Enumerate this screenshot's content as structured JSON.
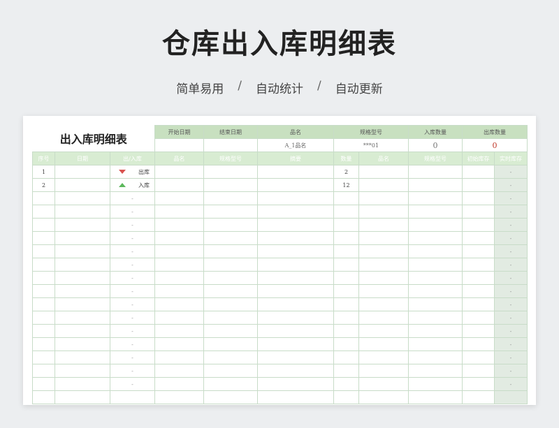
{
  "hero": {
    "title": "仓库出入库明细表",
    "tagline": [
      "简单易用",
      "自动统计",
      "自动更新"
    ],
    "separator": "/"
  },
  "sheet": {
    "title": "出入库明细表",
    "summary_headers": [
      "开始日期",
      "结束日期",
      "品名",
      "规格型号",
      "入库数量",
      "出库数量"
    ],
    "summary_values": {
      "start_date": "",
      "end_date": "",
      "product": "A_1品名",
      "spec": "***01",
      "in_qty": "0",
      "out_qty": "0"
    },
    "detail_headers": [
      "序号",
      "日期",
      "出/入库",
      "品名",
      "规格型号",
      "摘要",
      "数量"
    ],
    "stock_headers": [
      "品名",
      "规格型号",
      "初始库存",
      "实时库存"
    ],
    "rows": [
      {
        "seq": "1",
        "date": "",
        "io": "出库",
        "io_type": "out",
        "product": "",
        "spec": "",
        "summary": "",
        "qty": "2",
        "realtime": "-"
      },
      {
        "seq": "2",
        "date": "",
        "io": "入库",
        "io_type": "in",
        "product": "",
        "spec": "",
        "summary": "",
        "qty": "12",
        "realtime": "-"
      },
      {
        "seq": "",
        "io": "-",
        "realtime": "-"
      },
      {
        "seq": "",
        "io": "-",
        "realtime": "-"
      },
      {
        "seq": "",
        "io": "-",
        "realtime": "-"
      },
      {
        "seq": "",
        "io": "-",
        "realtime": "-"
      },
      {
        "seq": "",
        "io": "-",
        "realtime": "-"
      },
      {
        "seq": "",
        "io": "-",
        "realtime": "-"
      },
      {
        "seq": "",
        "io": "-",
        "realtime": "-"
      },
      {
        "seq": "",
        "io": "-",
        "realtime": "-"
      },
      {
        "seq": "",
        "io": "-",
        "realtime": "-"
      },
      {
        "seq": "",
        "io": "-",
        "realtime": "-"
      },
      {
        "seq": "",
        "io": "-",
        "realtime": "-"
      },
      {
        "seq": "",
        "io": "-",
        "realtime": "-"
      },
      {
        "seq": "",
        "io": "-",
        "realtime": "-"
      },
      {
        "seq": "",
        "io": "-",
        "realtime": "-"
      },
      {
        "seq": "",
        "io": "-",
        "realtime": "-"
      },
      {
        "seq": "",
        "io": "",
        "realtime": ""
      }
    ],
    "colors": {
      "header_green": "#c8e0c0",
      "header_light": "#d8ecd2",
      "out_marker": "#d9534f",
      "in_marker": "#5cb85c",
      "out_qty_value": "#c0392b"
    }
  }
}
